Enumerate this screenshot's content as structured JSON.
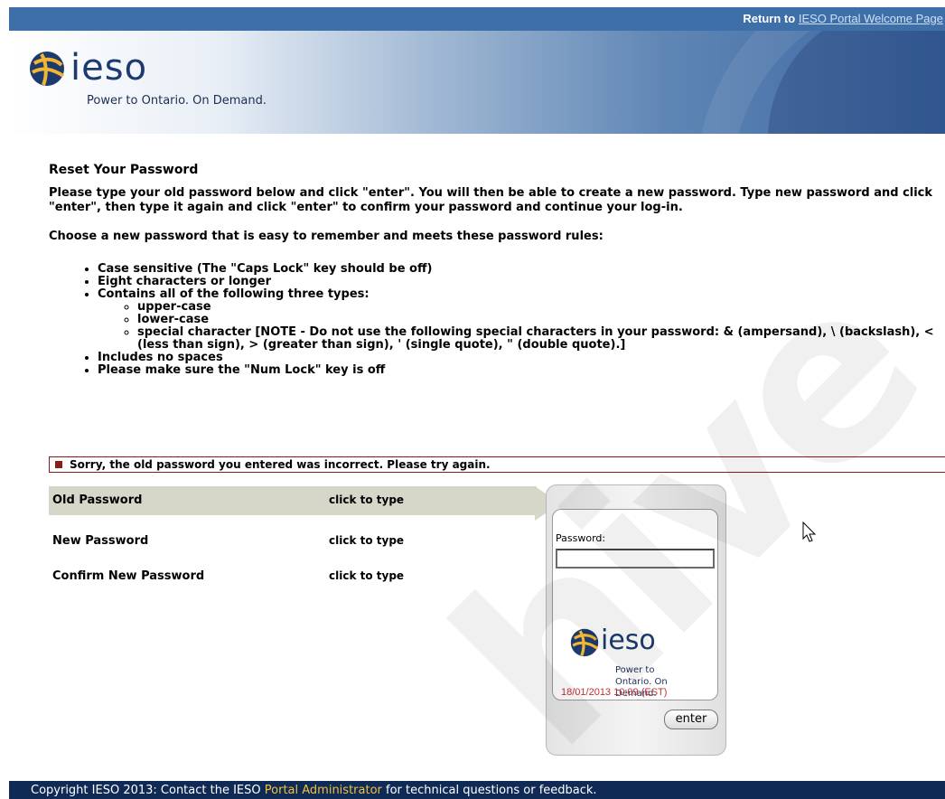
{
  "topbar": {
    "return_prefix": "Return to",
    "return_link": "IESO Portal Welcome Page"
  },
  "brand": {
    "name": "ieso",
    "tagline": "Power to Ontario. On Demand."
  },
  "heading": "Reset Your Password",
  "intro": "Please type your old password below and click \"enter\". You will then be able to create a new password. Type new password and click \"enter\", then type it again and click \"enter\" to confirm your password and continue your log-in.",
  "choose": "Choose a new password that is easy to remember and meets these password rules:",
  "rules": {
    "r1": "Case sensitive (The \"Caps Lock\" key should be off)",
    "r2": "Eight characters or longer",
    "r3": "Contains all of the following three types:",
    "sub1": "upper-case",
    "sub2": "lower-case",
    "sub3": "special character [NOTE - Do not use the following special characters in your password: & (ampersand), \\ (backslash), < (less than sign), > (greater than sign), ' (single quote), \" (double quote).]",
    "r4": "Includes no spaces",
    "r5": "Please make sure the \"Num Lock\" key is off"
  },
  "error": "Sorry, the old password you entered was incorrect. Please try again.",
  "fields": {
    "old": {
      "label": "Old Password",
      "hint": "click to type"
    },
    "new": {
      "label": "New Password",
      "hint": "click to type"
    },
    "confirm": {
      "label": "Confirm New Password",
      "hint": "click to type"
    }
  },
  "panel": {
    "password_label": "Password:",
    "password_value": "",
    "brand": "ieso",
    "tagline": "Power to Ontario. On Demand.",
    "timestamp": "18/01/2013 10:09 (EST)",
    "enter_label": "enter"
  },
  "watermark": "hive",
  "footer": {
    "prefix": "Copyright IESO 2013: Contact the IESO",
    "link": "Portal Administrator",
    "suffix": "for technical questions or feedback."
  },
  "colors": {
    "topbar": "#3f6fa8",
    "footer": "#102a56",
    "error": "#8b1a1a",
    "active_row": "#d7d7c9",
    "timestamp": "#c03030"
  }
}
